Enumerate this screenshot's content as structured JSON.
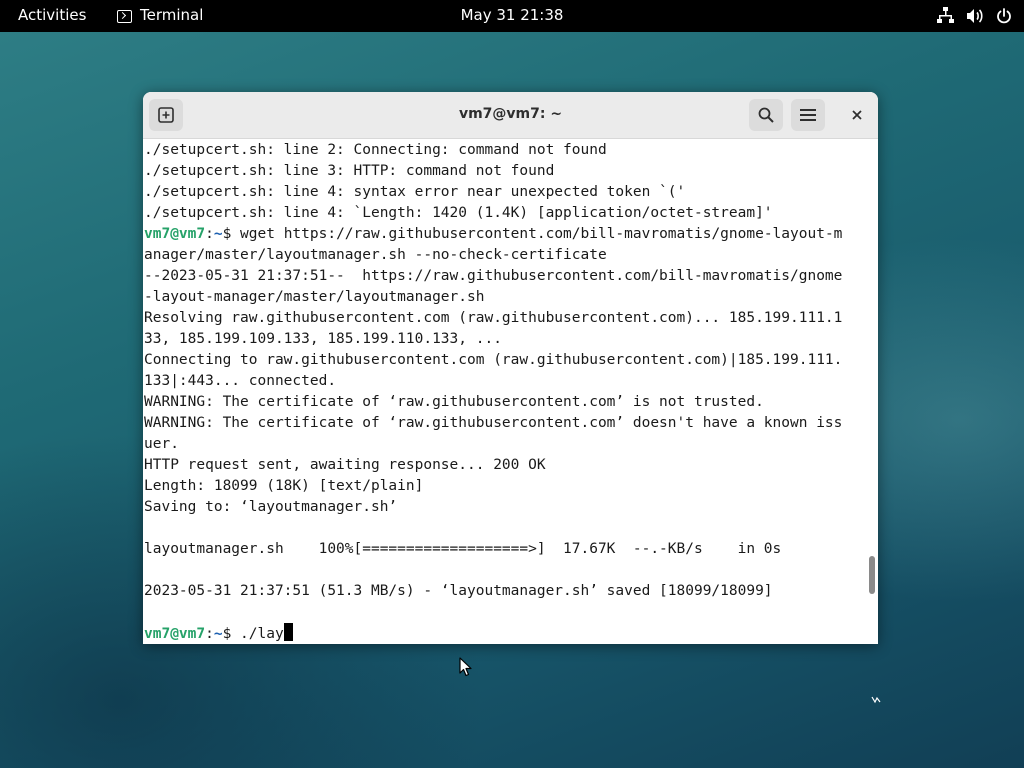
{
  "topbar": {
    "activities": "Activities",
    "app_name": "Terminal",
    "clock": "May 31  21:38",
    "tray_icons": [
      "network-icon",
      "volume-icon",
      "power-icon"
    ]
  },
  "window": {
    "title": "vm7@vm7: ~",
    "buttons": [
      "new-tab-icon",
      "search-icon",
      "menu-icon",
      "close-icon"
    ]
  },
  "terminal": {
    "lines": [
      "./setupcert.sh: line 2: Connecting: command not found",
      "./setupcert.sh: line 3: HTTP: command not found",
      "./setupcert.sh: line 4: syntax error near unexpected token `('",
      "./setupcert.sh: line 4: `Length: 1420 (1.4K) [application/octet-stream]'",
      "anager/master/layoutmanager.sh --no-check-certificate",
      "--2023-05-31 21:37:51--  https://raw.githubusercontent.com/bill-mavromatis/gnome",
      "-layout-manager/master/layoutmanager.sh",
      "Resolving raw.githubusercontent.com (raw.githubusercontent.com)... 185.199.111.1",
      "33, 185.199.109.133, 185.199.110.133, ...",
      "Connecting to raw.githubusercontent.com (raw.githubusercontent.com)|185.199.111.",
      "133|:443... connected.",
      "WARNING: The certificate of ‘raw.githubusercontent.com’ is not trusted.",
      "WARNING: The certificate of ‘raw.githubusercontent.com’ doesn't have a known iss",
      "uer.",
      "HTTP request sent, awaiting response... 200 OK",
      "Length: 18099 (18K) [text/plain]",
      "Saving to: ‘layoutmanager.sh’",
      "layoutmanager.sh    100%[===================>]  17.67K  --.-KB/s    in 0s",
      "2023-05-31 21:37:51 (51.3 MB/s) - ‘layoutmanager.sh’ saved [18099/18099]"
    ],
    "prompt_user": "vm7@vm7",
    "prompt_sep": ":",
    "prompt_path": "~",
    "prompt_symbol": "$ ",
    "wget_command": "wget https://raw.githubusercontent.com/bill-mavromatis/gnome-layout-m",
    "current_input": "./lay"
  }
}
